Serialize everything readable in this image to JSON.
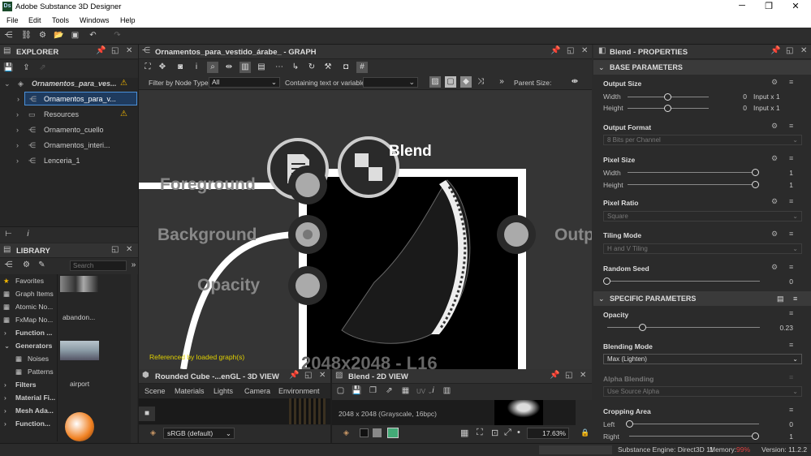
{
  "app": {
    "logo": "Ds",
    "title": "Adobe Substance 3D Designer"
  },
  "menu": [
    "File",
    "Edit",
    "Tools",
    "Windows",
    "Help"
  ],
  "explorer": {
    "title": "EXPLORER",
    "items": [
      {
        "label": "Ornamentos_para_ves...",
        "warn": true
      },
      {
        "label": "Ornamentos_para_v..."
      },
      {
        "label": "Resources",
        "warn": true
      },
      {
        "label": "Ornamento_cuello"
      },
      {
        "label": "Ornamentos_interi..."
      },
      {
        "label": "Lenceria_1"
      }
    ]
  },
  "library": {
    "title": "LIBRARY",
    "search_placeholder": "Search",
    "categories": [
      "Favorites",
      "Graph Items",
      "Atomic No...",
      "FxMap No...",
      "Function ...",
      "Generators",
      "Noises",
      "Patterns",
      "Filters",
      "Material Fi...",
      "Mesh Ada...",
      "Function..."
    ],
    "thumbs": [
      "abandon...",
      "airport"
    ]
  },
  "graph": {
    "title": "Ornamentos_para_vestido_árabe_ - GRAPH",
    "filter_label": "Filter by Node Type",
    "filter_value": "All",
    "contains_label": "Containing text or variable",
    "parent_size_label": "Parent Size:",
    "node_title": "Blend",
    "inputs": [
      "Foreground",
      "Background",
      "Opacity"
    ],
    "output_label": "Outp",
    "size_text": "2048x2048 - L16",
    "footer_note": "Referenced by loaded graph(s)"
  },
  "view3d": {
    "title": "Rounded Cube -...enGL - 3D VIEW",
    "tabs": [
      "Scene",
      "Materials",
      "Lights",
      "Camera",
      "Environment"
    ],
    "colorspace": "sRGB (default)"
  },
  "view2d": {
    "title": "Blend - 2D VIEW",
    "info": "2048 x 2048 (Grayscale, 16bpc)",
    "zoom": "17.63%",
    "uv_label": "UV"
  },
  "properties": {
    "title": "Blend - PROPERTIES",
    "base_section": "BASE PARAMETERS",
    "specific_section": "SPECIFIC PARAMETERS",
    "output_size": {
      "label": "Output Size",
      "width_label": "Width",
      "height_label": "Height",
      "width_value": "0",
      "height_value": "0",
      "width_suffix": "Input x 1",
      "height_suffix": "Input x 1"
    },
    "output_format": {
      "label": "Output Format",
      "value": "8 Bits per Channel"
    },
    "pixel_size": {
      "label": "Pixel Size",
      "width_label": "Width",
      "height_label": "Height",
      "width_value": "1",
      "height_value": "1"
    },
    "pixel_ratio": {
      "label": "Pixel Ratio",
      "value": "Square"
    },
    "tiling_mode": {
      "label": "Tiling Mode",
      "value": "H and V Tiling"
    },
    "random_seed": {
      "label": "Random Seed",
      "value": "0"
    },
    "opacity": {
      "label": "Opacity",
      "value": "0.23",
      "fraction": 0.23
    },
    "blending_mode": {
      "label": "Blending Mode",
      "value": "Max (Lighten)"
    },
    "alpha_blending": {
      "label": "Alpha Blending",
      "value": "Use Source Alpha"
    },
    "cropping_area": {
      "label": "Cropping Area",
      "left_label": "Left",
      "right_label": "Right",
      "left_value": "0",
      "right_value": "1"
    }
  },
  "status": {
    "engine": "Substance Engine: Direct3D 11",
    "memory_label": "Memory:",
    "memory_value": "99%",
    "version": "Version: 11.2.2"
  },
  "colors": {
    "accent": "#4a90d9",
    "warning": "#f5b800",
    "memory": "#e04040"
  }
}
